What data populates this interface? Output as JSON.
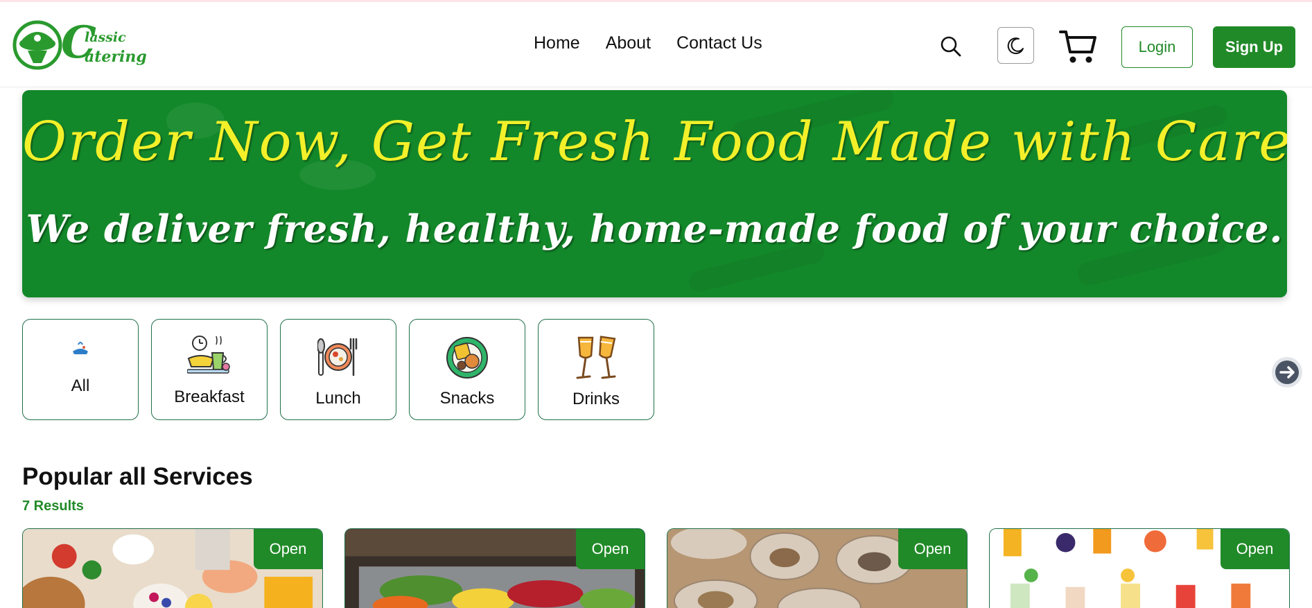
{
  "brand": {
    "logo_line1": "lassic",
    "logo_line2": "atering",
    "logo_initial": "C"
  },
  "nav": {
    "items": [
      "Home",
      "About",
      "Contact Us"
    ]
  },
  "header": {
    "login_label": "Login",
    "signup_label": "Sign Up"
  },
  "icons": {
    "search": "search-icon",
    "theme": "moon-icon",
    "cart": "cart-icon",
    "next": "arrow-right-circle-icon"
  },
  "colors": {
    "brand_green": "#218a28",
    "banner_green": "#13882a",
    "banner_title": "#f3f02a",
    "card_border": "#1f6f4a"
  },
  "banner": {
    "title": "Order Now, Get Fresh Food Made with Care!",
    "subtitle": "We deliver fresh, healthy, home-made food of your choice."
  },
  "categories": [
    {
      "label": "All",
      "icon": "all-food-icon"
    },
    {
      "label": "Breakfast",
      "icon": "breakfast-icon"
    },
    {
      "label": "Lunch",
      "icon": "lunch-plate-icon"
    },
    {
      "label": "Snacks",
      "icon": "snacks-icon"
    },
    {
      "label": "Drinks",
      "icon": "drinks-glasses-icon"
    }
  ],
  "popular": {
    "title": "Popular all Services",
    "count": "7 Results",
    "cards": [
      {
        "status": "Open",
        "image": "breakfast-spread-image"
      },
      {
        "status": "Open",
        "image": "buffet-salad-image"
      },
      {
        "status": "Open",
        "image": "meal-containers-image"
      },
      {
        "status": "Open",
        "image": "fruit-juices-image"
      }
    ]
  }
}
